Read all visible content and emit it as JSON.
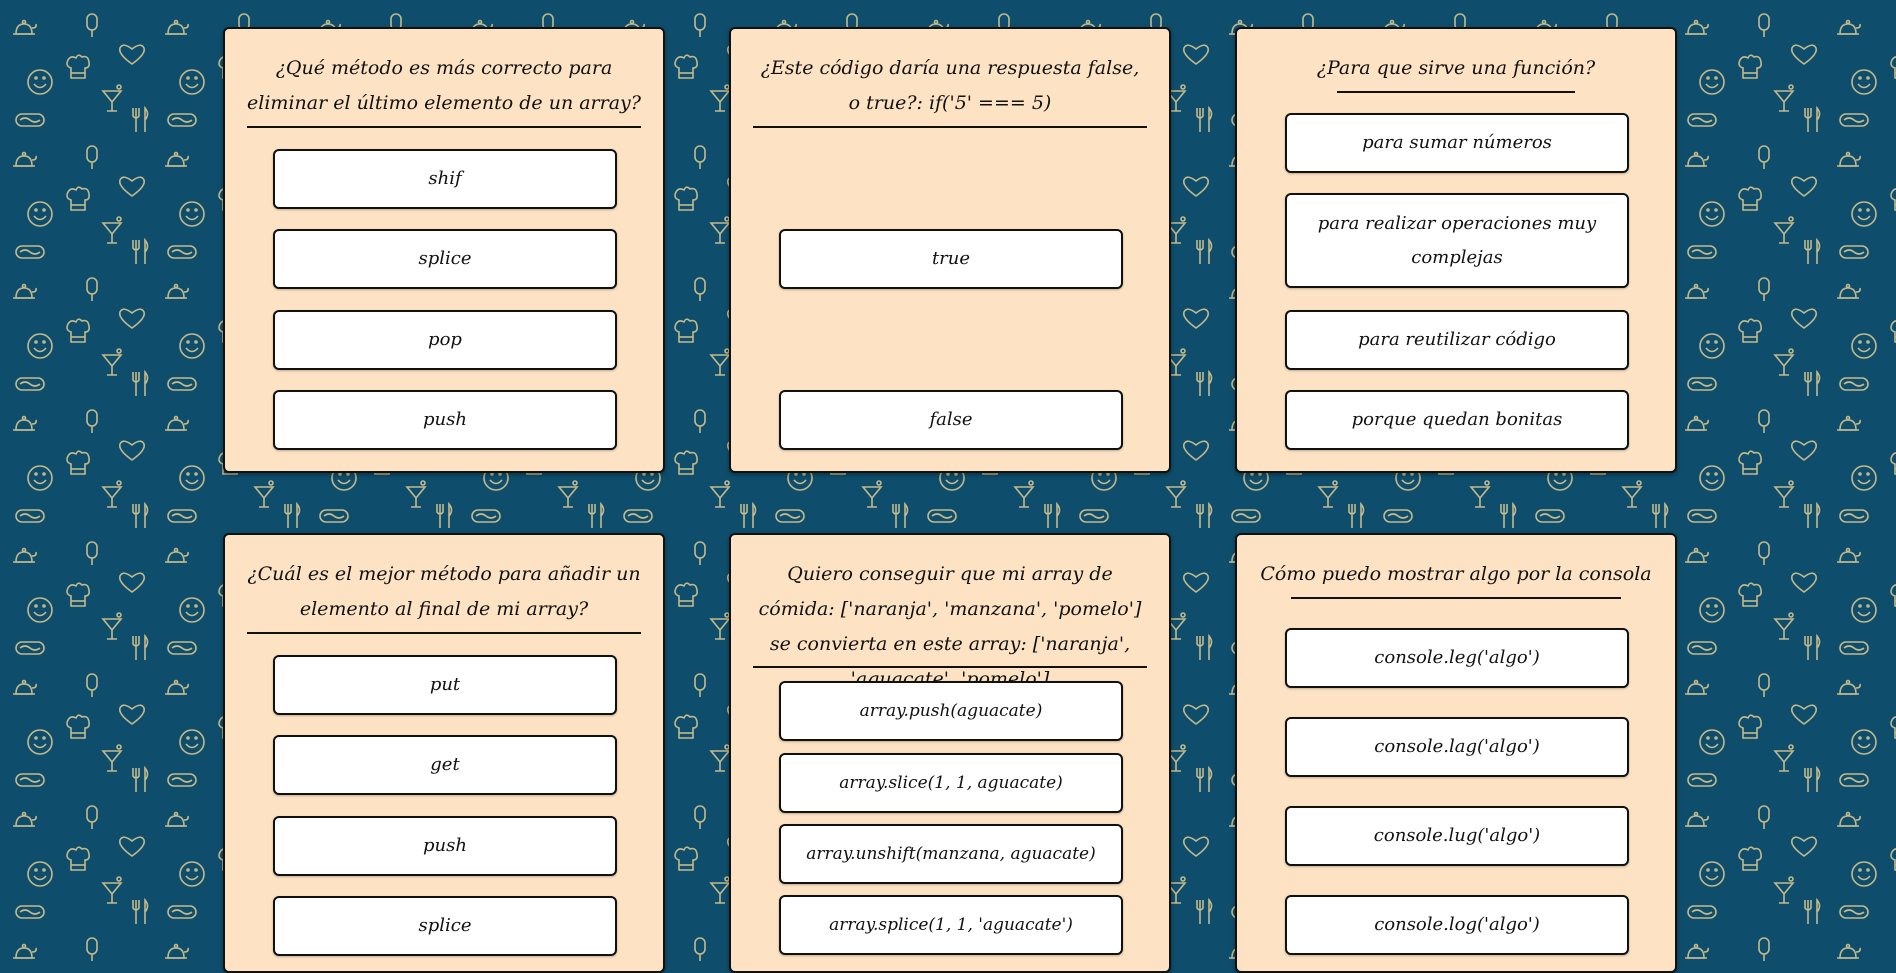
{
  "colors": {
    "background": "#0e4e6c",
    "pattern_stroke": "#c3b98b",
    "card": "#fde3c3",
    "option": "#ffffff",
    "border": "#111111"
  },
  "pattern_icons": [
    "teapot-icon",
    "popsicle-icon",
    "cocktail-icon",
    "hotdog-icon",
    "smiley-icon",
    "chef-hat-icon",
    "heart-icon",
    "cutlery-icon"
  ],
  "cards": [
    {
      "question": "¿Qué método es más correcto para eliminar el último elemento de un array?",
      "options": [
        "shif",
        "splice",
        "pop",
        "push"
      ]
    },
    {
      "question": "¿Este código daría una respuesta false, o true?: if('5' === 5)",
      "options": [
        "true",
        "false"
      ]
    },
    {
      "question": "¿Para que sirve una función?",
      "options": [
        "para sumar números",
        "para realizar operaciones muy complejas",
        "para reutilizar código",
        "porque quedan bonitas"
      ]
    },
    {
      "question": "¿Cuál es el mejor método para añadir un elemento al final de mi array?",
      "options": [
        "put",
        "get",
        "push",
        "splice"
      ]
    },
    {
      "question": "Quiero conseguir que mi array de cómida: ['naranja', 'manzana', 'pomelo'] se convierta en este array: ['naranja', 'aguacate', 'pomelo']",
      "options": [
        "array.push(aguacate)",
        "array.slice(1, 1, aguacate)",
        "array.unshift(manzana, aguacate)",
        "array.splice(1, 1, 'aguacate')"
      ]
    },
    {
      "question": "Cómo puedo mostrar algo por la consola",
      "options": [
        "console.leg('algo')",
        "console.lag('algo')",
        "console.lug('algo')",
        "console.log('algo')"
      ]
    }
  ]
}
